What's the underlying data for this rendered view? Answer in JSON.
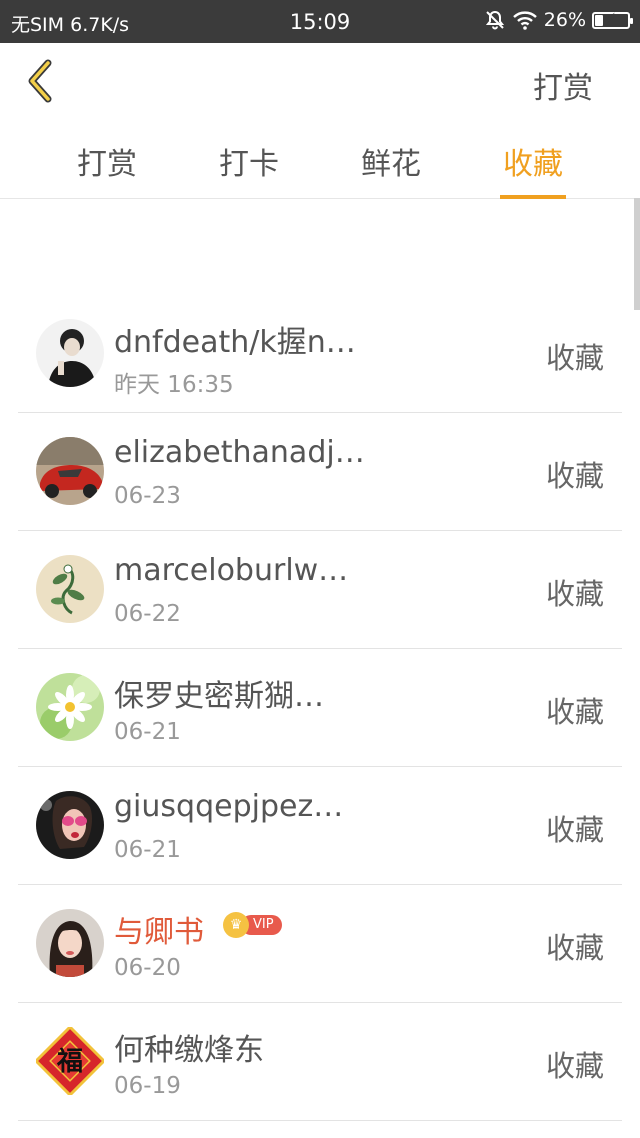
{
  "status_bar": {
    "carrier": "无SIM",
    "speed": "6.7K/s",
    "time": "15:09",
    "battery": "26%",
    "battery_level": 0.26,
    "icons": [
      "mute-bell-icon",
      "wifi-icon",
      "battery-charging-icon"
    ]
  },
  "header": {
    "back_icon": "chevron-left-icon",
    "action_label": "打赏"
  },
  "tabs": [
    {
      "label": "打赏",
      "active": false
    },
    {
      "label": "打卡",
      "active": false
    },
    {
      "label": "鲜花",
      "active": false
    },
    {
      "label": "收藏",
      "active": true
    }
  ],
  "list": [
    {
      "name": "dnfdeath/k握n…",
      "date": "昨天 16:35",
      "action": "收藏",
      "vip": false,
      "avatar": "user-photo-1"
    },
    {
      "name": "elizabethanadj…",
      "date": "06-23",
      "action": "收藏",
      "vip": false,
      "avatar": "red-car-photo"
    },
    {
      "name": "marceloburlw…",
      "date": "06-22",
      "action": "收藏",
      "vip": false,
      "avatar": "plant-drawing"
    },
    {
      "name": "保罗史密斯猢…",
      "date": "06-21",
      "action": "收藏",
      "vip": false,
      "avatar": "flower-photo"
    },
    {
      "name": "giusqqepjpez…",
      "date": "06-21",
      "action": "收藏",
      "vip": false,
      "avatar": "sunglasses-photo"
    },
    {
      "name": "与卿书",
      "date": "06-20",
      "action": "收藏",
      "vip": true,
      "vip_label": "VIP",
      "avatar": "woman-photo"
    },
    {
      "name": "何种缴烽东",
      "date": "06-19",
      "action": "收藏",
      "vip": false,
      "avatar": "fu-character",
      "avatar_text": "福"
    }
  ],
  "colors": {
    "accent": "#f0a020",
    "vip_name": "#e05a3a",
    "status_bar": "#3b3b3b"
  }
}
